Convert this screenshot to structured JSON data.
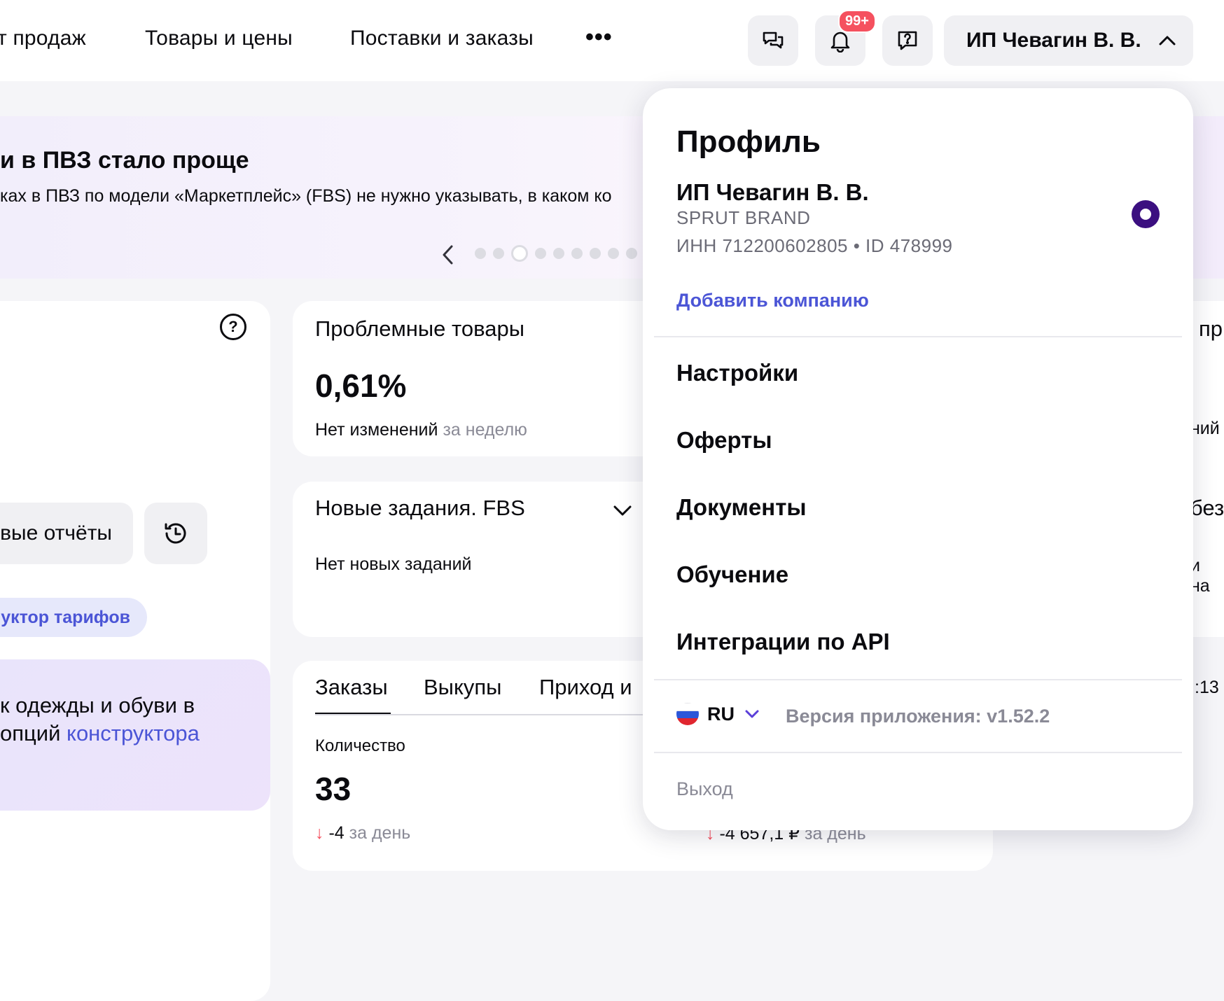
{
  "nav": {
    "items": [
      "т продаж",
      "Товары и цены",
      "Поставки и заказы"
    ],
    "more": "•••"
  },
  "header": {
    "notifications_badge": "99+",
    "user_button_label": "ИП Чевагин В. В.",
    "icons": [
      "chat-icon",
      "bell-icon",
      "support-icon",
      "chevron-up-icon"
    ]
  },
  "banner": {
    "title": "и в ПВЗ стало проще",
    "text": "ках в ПВЗ по модели «Маркетплейс» (FBS) не нужно указывать, в каком ко",
    "dots_count": 9,
    "active_dot": 2
  },
  "left_panel": {
    "reports_label": "вые отчёты",
    "tariff_label": "уктор тарифов",
    "promo_line1": "к одежды и обуви в",
    "promo_line2_prefix": "опций ",
    "promo_line2_link": "конструктора"
  },
  "problem_card": {
    "title": "Проблемные товары",
    "value": "0,61%",
    "status": "Нет изменений",
    "period": "за неделю"
  },
  "tasks_card": {
    "title": "Новые задания. FBS",
    "status": "Нет новых заданий"
  },
  "orders_card": {
    "tabs": [
      "Заказы",
      "Выкупы",
      "Приход и"
    ],
    "quantity_label": "Количество",
    "quantity_value": "33",
    "quantity_delta": "-4",
    "delta_period": "за день",
    "amount_delta": "-4 657,1 ₽",
    "amount_period": "за день"
  },
  "right_partial": {
    "line1": "пр",
    "line2": "ний",
    "line3": "без",
    "line4": "и на",
    "line5": ":13"
  },
  "profile_menu": {
    "title": "Профиль",
    "company_name": "ИП Чевагин В. В.",
    "brand": "SPRUT BRAND",
    "inn_line": "ИНН 712200602805 • ID 478999",
    "add_company": "Добавить компанию",
    "items": [
      "Настройки",
      "Оферты",
      "Документы",
      "Обучение",
      "Интеграции по API"
    ],
    "lang": "RU",
    "version": "Версия приложения: v1.52.2",
    "logout": "Выход"
  },
  "colors": {
    "accent_link": "#4b55d6",
    "radio_selected": "#3b0f80",
    "badge": "#f5515f",
    "negative": "#f5515f"
  }
}
